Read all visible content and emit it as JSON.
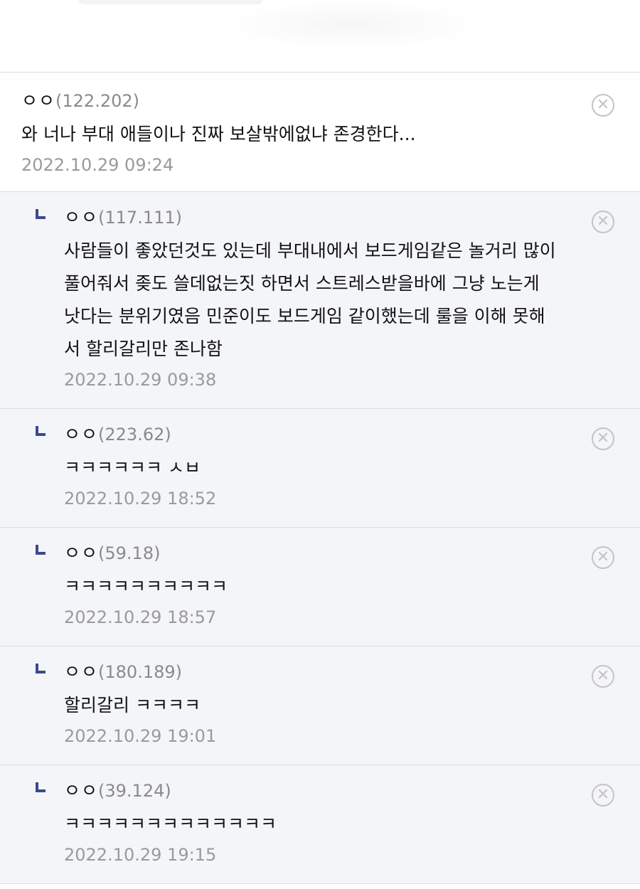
{
  "comments": [
    {
      "nick": "ㅇㅇ",
      "ip": "(122.202)",
      "lines": [
        "와 너나 부대 애들이나 진짜 보살밖에없냐 존경한다..."
      ],
      "date": "2022.10.29 09:24"
    }
  ],
  "replies": [
    {
      "nick": "ㅇㅇ",
      "ip": "(117.111)",
      "lines": [
        "사람들이 좋았던것도 있는데 부대내에서 보드게임같은 놀거리 많이",
        "풀어줘서 좆도 쓸데없는짓 하면서 스트레스받을바에 그냥 노는게",
        "낫다는 분위기였음 민준이도 보드게임 같이했는데 룰을 이해 못해",
        "서 할리갈리만 존나함"
      ],
      "date": "2022.10.29 09:38"
    },
    {
      "nick": "ㅇㅇ",
      "ip": "(223.62)",
      "lines": [
        "ㅋㅋㅋㅋㅋㅋ ㅅㅂ"
      ],
      "date": "2022.10.29 18:52"
    },
    {
      "nick": "ㅇㅇ",
      "ip": "(59.18)",
      "lines": [
        "ㅋㅋㅋㅋㅋㅋㅋㅋㅋㅋ"
      ],
      "date": "2022.10.29 18:57"
    },
    {
      "nick": "ㅇㅇ",
      "ip": "(180.189)",
      "lines": [
        "할리갈리 ㅋㅋㅋㅋ"
      ],
      "date": "2022.10.29 19:01"
    },
    {
      "nick": "ㅇㅇ",
      "ip": "(39.124)",
      "lines": [
        "ㅋㅋㅋㅋㅋㅋㅋㅋㅋㅋㅋㅋㅋ"
      ],
      "date": "2022.10.29 19:15"
    }
  ],
  "icons": {
    "delete": "close-circle-icon",
    "reply": "reply-arrow-icon"
  },
  "colors": {
    "reply_background": "#f4f5f9",
    "reply_mark": "#3a4a8f",
    "ip_text": "#8a8a8a",
    "date_text": "#9a9a9a"
  }
}
